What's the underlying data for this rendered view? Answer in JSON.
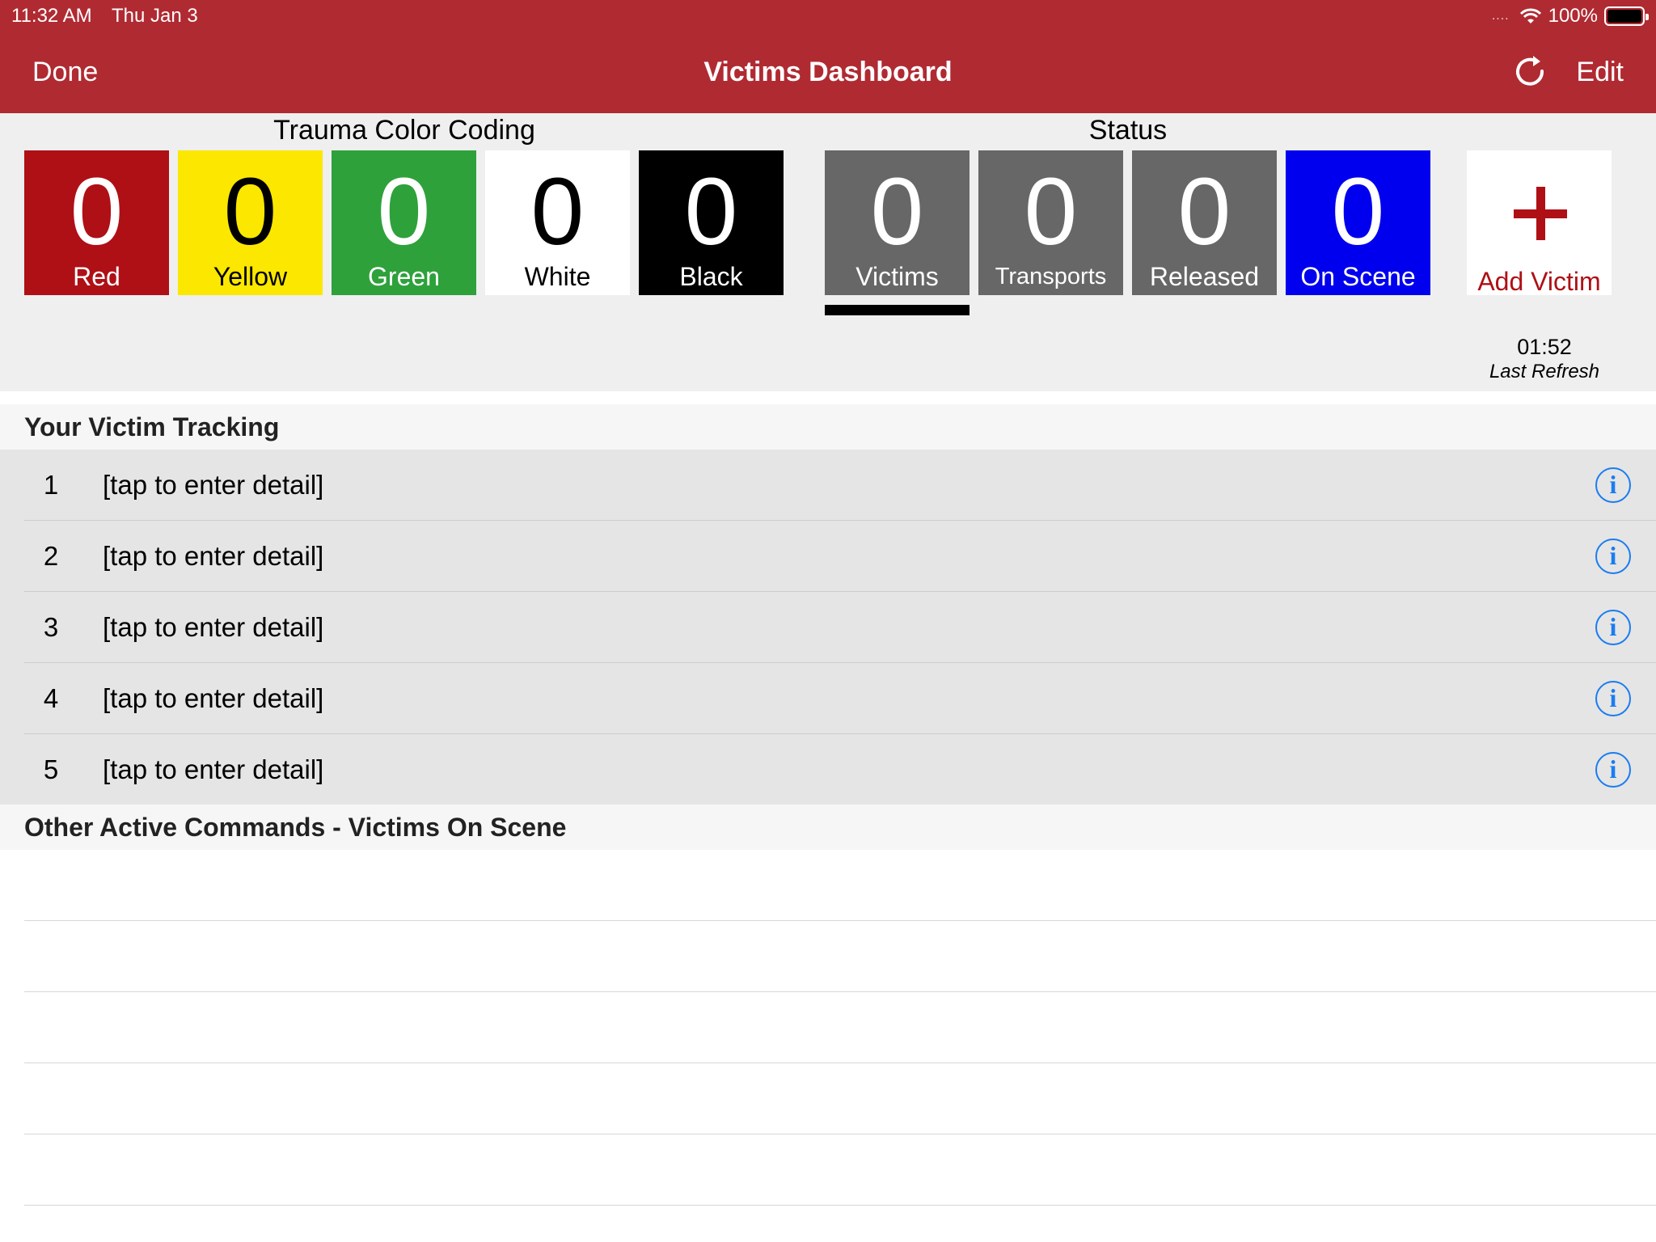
{
  "status_bar": {
    "time": "11:32 AM",
    "date": "Thu Jan 3",
    "signal_dots": "....",
    "battery": "100%"
  },
  "nav": {
    "done_label": "Done",
    "title": "Victims Dashboard",
    "edit_label": "Edit",
    "refresh_icon": "refresh-icon"
  },
  "trauma": {
    "label": "Trauma Color Coding",
    "tiles": [
      {
        "count": "0",
        "label": "Red",
        "color": "#ae1016"
      },
      {
        "count": "0",
        "label": "Yellow",
        "color": "#fbe700"
      },
      {
        "count": "0",
        "label": "Green",
        "color": "#2ea13b"
      },
      {
        "count": "0",
        "label": "White",
        "color": "#ffffff"
      },
      {
        "count": "0",
        "label": "Black",
        "color": "#000000"
      }
    ]
  },
  "status": {
    "label": "Status",
    "tiles": [
      {
        "count": "0",
        "label": "Victims",
        "color": "#676767",
        "selected": true
      },
      {
        "count": "0",
        "label": "Transports",
        "color": "#676767"
      },
      {
        "count": "0",
        "label": "Released",
        "color": "#676767"
      },
      {
        "count": "0",
        "label": "On Scene",
        "color": "#0000ee"
      }
    ],
    "add_label": "Add Victim",
    "add_icon": "plus-icon"
  },
  "refresh": {
    "time": "01:52",
    "label": "Last Refresh"
  },
  "tracking": {
    "title": "Your Victim Tracking",
    "rows": [
      {
        "num": "1",
        "detail": "[tap to enter detail]"
      },
      {
        "num": "2",
        "detail": "[tap to enter detail]"
      },
      {
        "num": "3",
        "detail": "[tap to enter detail]"
      },
      {
        "num": "4",
        "detail": "[tap to enter detail]"
      },
      {
        "num": "5",
        "detail": "[tap to enter detail]"
      }
    ],
    "info_icon": "info-icon",
    "info_glyph": "i"
  },
  "other": {
    "title": "Other Active Commands - Victims On Scene"
  },
  "colors": {
    "header": "#b02a32",
    "accent_blue": "#1a7cf0"
  }
}
